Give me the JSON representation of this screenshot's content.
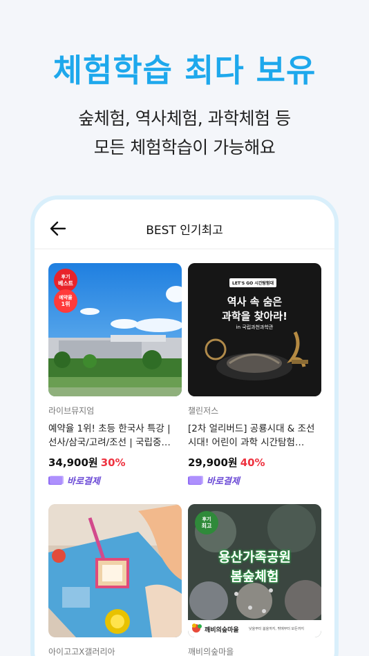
{
  "hero": {
    "headline": "체험학습 최다 보유",
    "subline_1": "숲체험, 역사체험, 과학체험 등",
    "subline_2": "모든 체험학습이 가능해요"
  },
  "appbar": {
    "back_icon": "arrow-left-icon",
    "title": "BEST 인기최고"
  },
  "products": [
    {
      "vendor": "라이브뮤지엄",
      "title": "예약율 1위! 초등 한국사 특강 | 선사/삼국/고려/조선 | 국립중…",
      "price": "34,900원",
      "discount": "30%",
      "pay_label": "바로결제",
      "badges": [
        {
          "top": "후기",
          "main": "베스트"
        },
        {
          "top": "예약율",
          "main": "1위"
        }
      ]
    },
    {
      "vendor": "챌린저스",
      "title": "[2차 얼리버드] 공룡시대 & 조선시대! 어린이 과학 시간탐험…",
      "price": "29,900원",
      "discount": "40%",
      "pay_label": "바로결제",
      "image_tag": "LET'S GO 시간탐험대",
      "image_title_1": "역사 속 숨은",
      "image_title_2": "과학을 찾아라!",
      "image_sub": "in 국립과천과학관"
    },
    {
      "vendor": "아이고고X갤러리아"
    },
    {
      "vendor": "깨비의숲마을",
      "badge": {
        "top": "후기",
        "main": "최고"
      },
      "image_title_1": "용산가족공원",
      "image_title_2": "봄숲체험",
      "image_brand": "깨비의숲마을",
      "image_footer": "낮을부터 봄을까지, 밖에부터 모든까지"
    }
  ],
  "colors": {
    "accent": "#1ea8ec",
    "discount": "#ee3340",
    "pay": "#6b4ad6"
  }
}
